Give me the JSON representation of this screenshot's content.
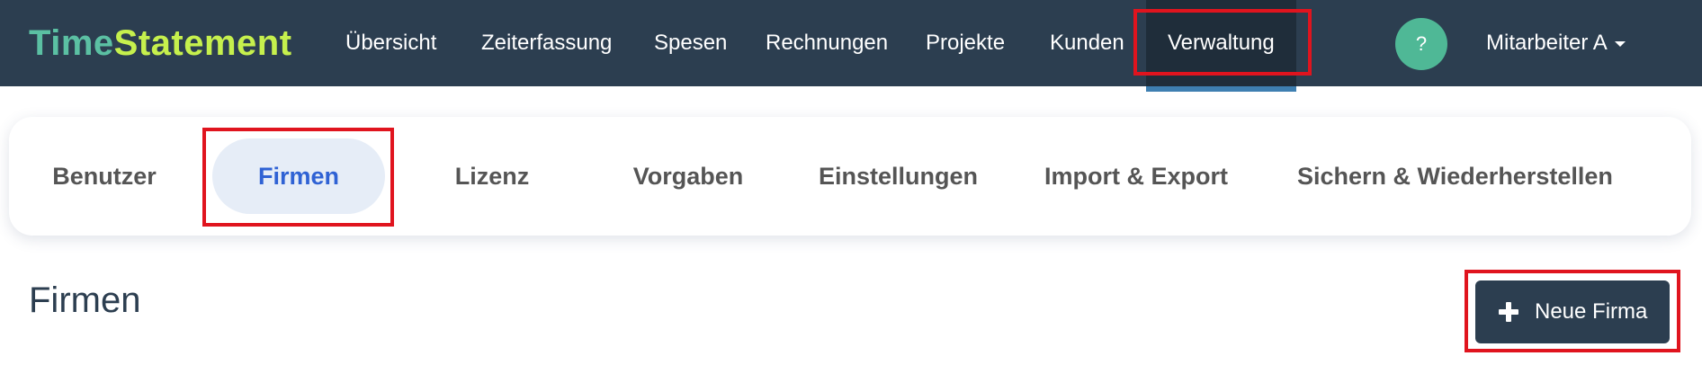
{
  "navbar": {
    "brand_part1": "Time",
    "brand_part2": "Statement",
    "items": [
      {
        "label": "Übersicht"
      },
      {
        "label": "Zeiterfassung"
      },
      {
        "label": "Spesen"
      },
      {
        "label": "Rechnungen"
      },
      {
        "label": "Projekte"
      },
      {
        "label": "Kunden"
      },
      {
        "label": "Verwaltung",
        "active": true
      }
    ],
    "help_label": "?",
    "user_label": "Mitarbeiter A"
  },
  "subtabs": [
    {
      "label": "Benutzer"
    },
    {
      "label": "Firmen",
      "active": true
    },
    {
      "label": "Lizenz"
    },
    {
      "label": "Vorgaben"
    },
    {
      "label": "Einstellungen"
    },
    {
      "label": "Import & Export"
    },
    {
      "label": "Sichern & Wiederherstellen"
    }
  ],
  "main": {
    "title": "Firmen",
    "new_button_label": "Neue Firma"
  },
  "colors": {
    "navbar_bg": "#2c3e50",
    "brand_time": "#5bc0a3",
    "brand_statement": "#c6f04d",
    "help_bg": "#4fb896",
    "active_tab_text": "#2f62d4",
    "active_tab_bg": "#e6edf7",
    "highlight": "#e0141e"
  }
}
